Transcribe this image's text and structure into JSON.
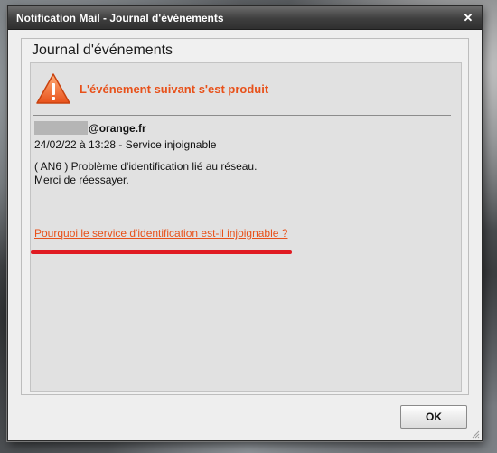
{
  "window": {
    "title": "Notification Mail - Journal d'événements",
    "close_icon": "close-icon"
  },
  "panel": {
    "title": "Journal d'événements"
  },
  "event": {
    "header": "L'événement suivant s'est produit",
    "warning_icon": "warning-icon",
    "email_domain": "@orange.fr",
    "datetime_line": "24/02/22 à 13:28 - Service injoignable",
    "message_line1": "( AN6 ) Problème d'identification lié au réseau.",
    "message_line2": "Merci de réessayer.",
    "help_link": "Pourquoi le service d'identification est-il injoignable ?"
  },
  "buttons": {
    "ok": "OK"
  },
  "colors": {
    "accent": "#e8511a",
    "annotation": "#e01b22",
    "titlebar": "#3e3e3e"
  }
}
